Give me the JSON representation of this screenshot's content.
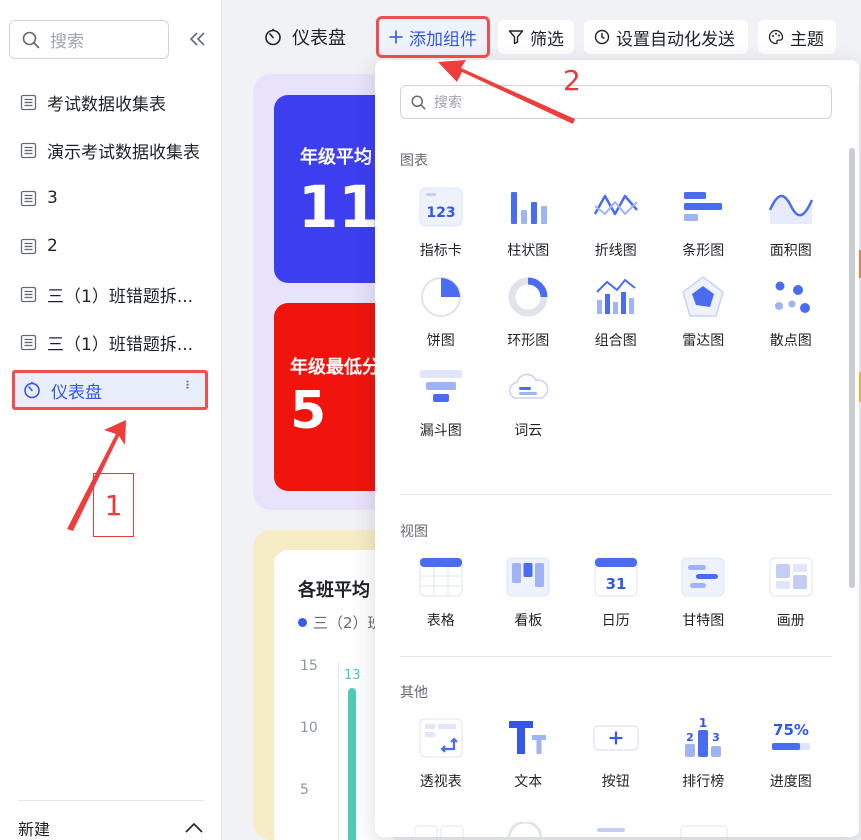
{
  "sidebar": {
    "search_placeholder": "搜索",
    "items": [
      {
        "label": "考试数据收集表",
        "icon": "table-icon"
      },
      {
        "label": "演示考试数据收集表",
        "icon": "table-icon"
      },
      {
        "label": "3",
        "icon": "table-icon"
      },
      {
        "label": "2",
        "icon": "table-icon"
      },
      {
        "label": "三（1）班错题拆...",
        "icon": "table-icon"
      },
      {
        "label": "三（1）班错题拆...",
        "icon": "table-icon"
      },
      {
        "label": "仪表盘",
        "icon": "dashboard-icon",
        "active": true
      }
    ],
    "footer_label": "新建"
  },
  "toolbar": {
    "title": "仪表盘",
    "add_widget": "添加组件",
    "filter": "筛选",
    "auto_send": "设置自动化发送",
    "theme": "主题"
  },
  "annotations": {
    "step1": "1",
    "step2": "2"
  },
  "dashboard": {
    "card1_label": "年级平均",
    "card1_value": "11",
    "card2_label": "年级最低分",
    "card2_value": "5",
    "chart_title": "各班平均",
    "legend": "三（2）班",
    "yticks": [
      "15",
      "10",
      "5"
    ],
    "bar_value": "13"
  },
  "dropdown": {
    "search_placeholder": "搜索",
    "sections": [
      {
        "title": "图表",
        "items": [
          "指标卡",
          "柱状图",
          "折线图",
          "条形图",
          "面积图",
          "饼图",
          "环形图",
          "组合图",
          "雷达图",
          "散点图",
          "漏斗图",
          "词云"
        ]
      },
      {
        "title": "视图",
        "items": [
          "表格",
          "看板",
          "日历",
          "甘特图",
          "画册"
        ]
      },
      {
        "title": "其他",
        "items": [
          "透视表",
          "文本",
          "按钮",
          "排行榜",
          "进度图"
        ]
      }
    ],
    "icon_texts": {
      "metric": "123",
      "calendar": "31",
      "progress": "75%",
      "ranking": "1"
    }
  },
  "colors": {
    "accent": "#3358e8",
    "annotation": "#e63b3b",
    "card_blue": "#3c3ef0",
    "card_red": "#f0140c",
    "teal": "#4ecab8"
  }
}
